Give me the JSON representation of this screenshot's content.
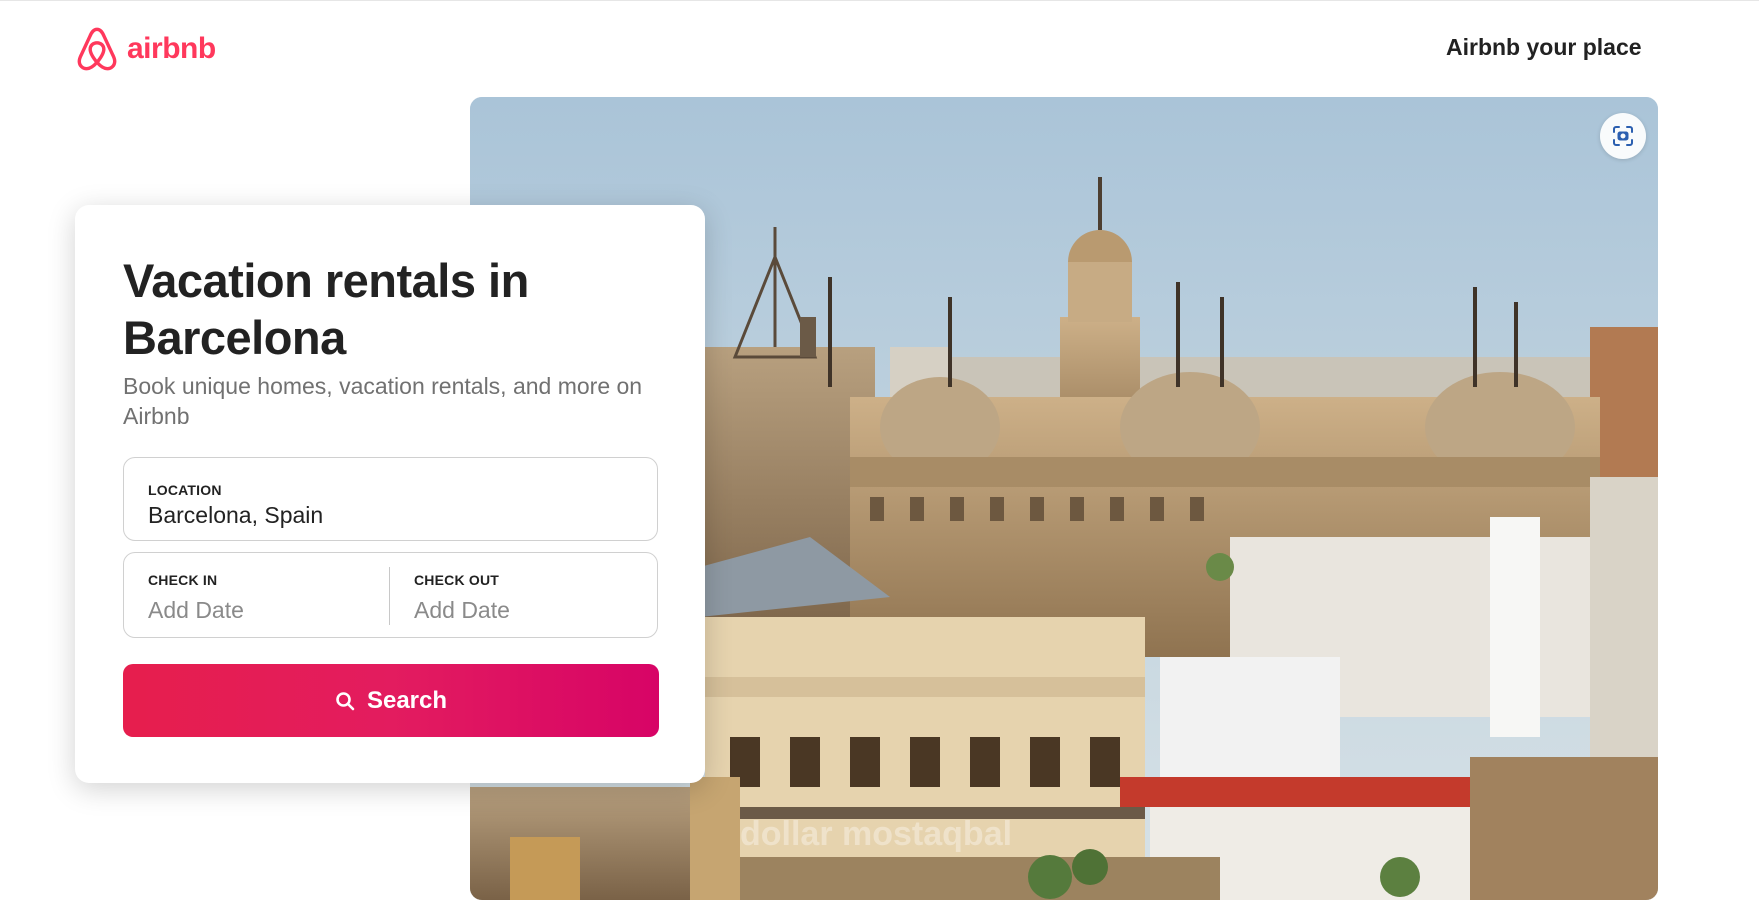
{
  "header": {
    "logo_text": "airbnb",
    "host_link": "Airbnb your place"
  },
  "colors": {
    "brand": "#FF385C",
    "button_gradient_start": "#E61E4D",
    "button_gradient_end": "#D70466",
    "text_primary": "#222222",
    "text_secondary": "#717171"
  },
  "hero": {
    "visual_search_icon": "camera-scan-icon",
    "watermark_text": "dollar mostaqbal"
  },
  "booking": {
    "title": "Vacation rentals in Barcelona",
    "subtitle": "Book unique homes, vacation rentals, and more on Airbnb",
    "location": {
      "label": "LOCATION",
      "value": "Barcelona, Spain"
    },
    "check_in": {
      "label": "CHECK IN",
      "placeholder": "Add Date"
    },
    "check_out": {
      "label": "CHECK OUT",
      "placeholder": "Add Date"
    },
    "search_button": {
      "label": "Search",
      "icon": "search-icon"
    }
  }
}
